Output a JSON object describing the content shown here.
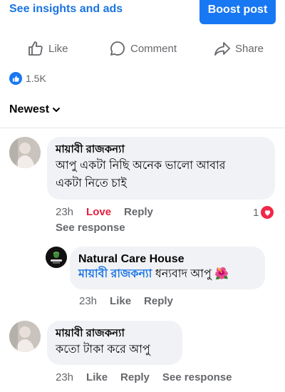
{
  "top": {
    "insights_label": "See insights and ads",
    "boost_label": "Boost post"
  },
  "actions": {
    "like": "Like",
    "comment": "Comment",
    "share": "Share"
  },
  "reactions": {
    "count": "1.5K"
  },
  "sort": {
    "label": "Newest"
  },
  "comments": [
    {
      "author": "মায়াবী রাজকন্যা",
      "line1": "আপু একটা নিছি অনেক  ভালো আবার",
      "line2": "একটা নিতে চাই",
      "time": "23h",
      "reaction_label": "Love",
      "reply_label": "Reply",
      "react_count": "1",
      "see_response": "See response"
    },
    {
      "author": "Natural Care House",
      "mention": "মায়াবী রাজকন্যা",
      "text": "ধন্যবাদ আপু",
      "emoji": "🌺",
      "time": "23h",
      "like_label": "Like",
      "reply_label": "Reply"
    },
    {
      "author": "মায়াবী রাজকন্যা",
      "text": "কতো টাকা করে আপু",
      "time": "23h",
      "like_label": "Like",
      "reply_label": "Reply",
      "see_response": "See response"
    }
  ]
}
